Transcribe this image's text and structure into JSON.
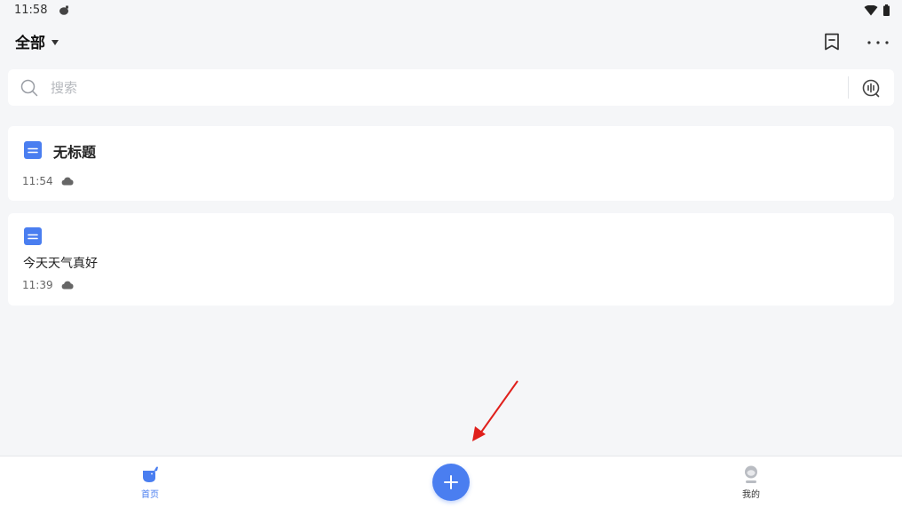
{
  "status_bar": {
    "time": "11:58"
  },
  "header": {
    "folder_label": "全部"
  },
  "search": {
    "placeholder": "搜索",
    "value": ""
  },
  "notes": [
    {
      "title": "无标题",
      "body": "",
      "time": "11:54"
    },
    {
      "title": "",
      "body": "今天天气真好",
      "time": "11:39"
    }
  ],
  "bottom_nav": {
    "home_label": "首页",
    "me_label": "我的"
  },
  "icons": {
    "status_app": "app-notification-icon",
    "wifi": "wifi-icon",
    "battery": "battery-icon",
    "bookmark": "bookmark-icon",
    "more": "more-dots-icon",
    "search": "search-icon",
    "voice": "voice-search-icon",
    "note": "document-icon",
    "sync": "cloud-icon",
    "add": "plus-icon"
  },
  "colors": {
    "accent": "#4a7ef0",
    "background": "#f5f6f8",
    "card": "#ffffff",
    "annotation_arrow": "#e0201c"
  }
}
